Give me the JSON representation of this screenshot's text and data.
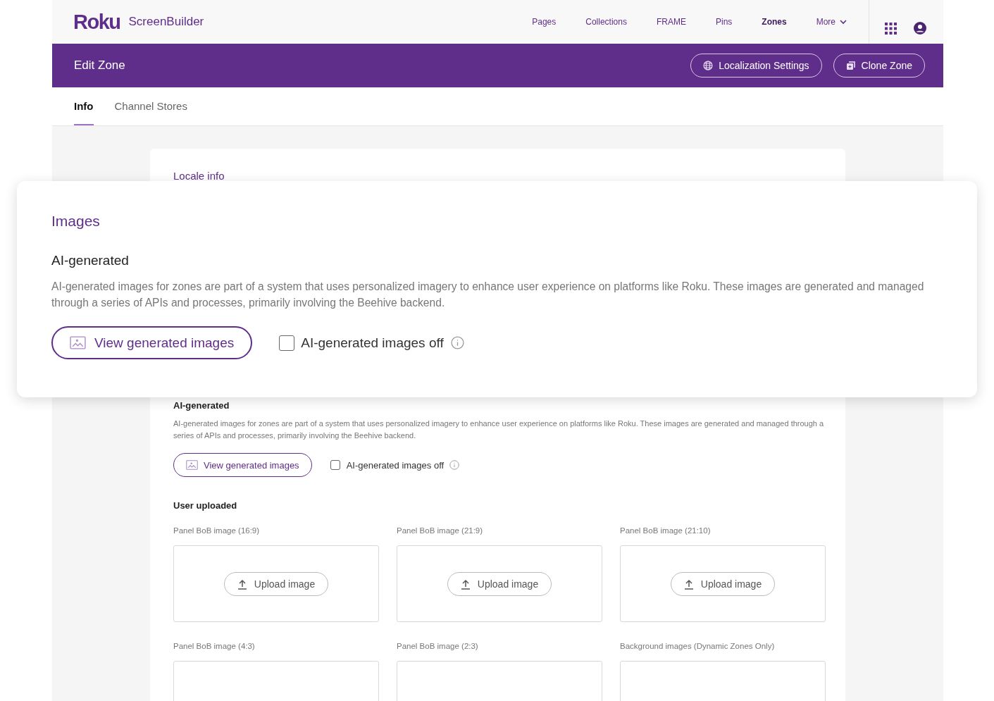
{
  "app": {
    "logo": "Roku",
    "product": "ScreenBuilder"
  },
  "nav": [
    {
      "label": "Pages",
      "kind": "link",
      "selected": false
    },
    {
      "label": "Collections",
      "kind": "link",
      "selected": false
    },
    {
      "label": "FRAME",
      "kind": "link",
      "selected": false
    },
    {
      "label": "Pins",
      "kind": "link",
      "selected": false
    },
    {
      "label": "Zones",
      "kind": "link",
      "selected": true
    },
    {
      "label": "More",
      "kind": "menu",
      "selected": false
    }
  ],
  "page_header": {
    "title": "Edit Zone",
    "buttons": [
      {
        "label": "Localization Settings",
        "kind": "localization"
      },
      {
        "label": "Clone Zone",
        "kind": "clone"
      }
    ]
  },
  "tabs": [
    {
      "label": "Info",
      "selected": true
    },
    {
      "label": "Channel Stores",
      "selected": false
    }
  ],
  "card": {
    "link": "Locale info",
    "ai_section": {
      "heading": "AI-generated",
      "description": "AI-generated images for zones are part of a system that uses personalized imagery to enhance user experience on platforms like Roku. These images are generated and managed through a series of APIs and processes, primarily involving the Beehive backend.",
      "button": "View generated images",
      "checkbox": {
        "label": "AI-generated images off",
        "checked": false
      }
    },
    "uploaded": {
      "heading": "User uploaded",
      "slots": [
        {
          "label": "Panel BoB image (16:9)",
          "button": "Upload image"
        },
        {
          "label": "Panel BoB image (21:9)",
          "button": "Upload image"
        },
        {
          "label": "Panel BoB image (21:10)",
          "button": "Upload image"
        },
        {
          "label": "Panel BoB image (4:3)"
        },
        {
          "label": "Panel BoB image (2:3)"
        },
        {
          "label": "Background images (Dynamic Zones Only)"
        }
      ]
    }
  },
  "callout": {
    "title": "Images",
    "ai_section": {
      "heading": "AI-generated",
      "description": "AI-generated images for zones are part of a system that uses personalized imagery to enhance user experience on platforms like Roku. These images are generated and managed through a series of APIs and processes, primarily involving the Beehive backend.",
      "button": "View generated images",
      "checkbox": {
        "label": "AI-generated images off",
        "checked": false
      }
    }
  }
}
